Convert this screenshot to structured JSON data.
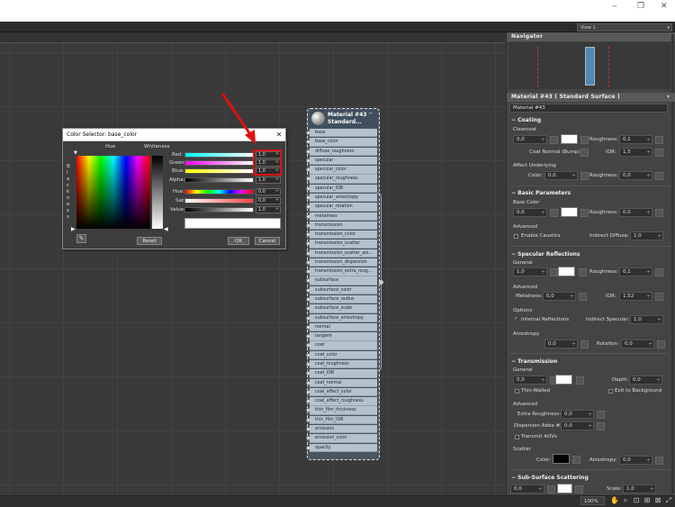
{
  "window": {
    "minimize": "‒",
    "maximize": "❐",
    "close": "✕",
    "view_select": "View 1"
  },
  "status": {
    "zoom": "100%"
  },
  "navigator": {
    "title": "Navigator"
  },
  "material_panel": {
    "header": "Material #43  ( Standard Surface )",
    "name": "Material #43",
    "coating": {
      "title": "Coating",
      "group": "Clearcoat",
      "weight": "0,0",
      "roughness_label": "Roughness:",
      "roughness": "0,1",
      "coat_normal_label": "Coat Normal (Bump):",
      "ior_label": "IOR:",
      "ior": "1,5",
      "affect_underlying": "Affect Underlying",
      "color_label": "Color:",
      "color_val": "0,0",
      "roughness2": "0,0"
    },
    "basic": {
      "title": "Basic Parameters",
      "group": "Base Color",
      "weight": "0,0",
      "roughness_label": "Roughness:",
      "roughness": "0,0",
      "advanced": "Advanced",
      "enable_caustics": "Enable Caustics",
      "indirect_diffuse_label": "Indirect Diffuse:",
      "indirect_diffuse": "1,0"
    },
    "specular": {
      "title": "Specular Reflections",
      "group": "General",
      "weight": "1,0",
      "roughness_label": "Roughness:",
      "roughness": "0,1",
      "advanced": "Advanced",
      "metalness_label": "Metalness:",
      "metalness": "0,0",
      "ior_label": "IOR:",
      "ior": "1,52",
      "options": "Options",
      "internal_reflections": "Internal Reflections",
      "indirect_specular_label": "Indirect Specular:",
      "indirect_specular": "1,0",
      "anisotropy": "Anisotropy",
      "anisotropy_val": "0,0",
      "rotation_label": "Rotation:",
      "rotation": "0,0"
    },
    "transmission": {
      "title": "Transmission",
      "group": "General",
      "weight": "0,0",
      "depth_label": "Depth:",
      "depth": "0,0",
      "thin_walled": "Thin-Walled",
      "exit_to_background": "Exit to Background",
      "advanced": "Advanced",
      "extra_roughness_label": "Extra Roughness:",
      "extra_roughness": "0,0",
      "dispersion_label": "Dispersion Abbe #:",
      "dispersion": "0,0",
      "transmit_aovs": "Transmit AOVs",
      "scatter": "Scatter",
      "color_label": "Color:",
      "anisotropy_label": "Anisotropy:",
      "anisotropy": "0,0"
    },
    "sss": {
      "title": "Sub-Surface Scattering",
      "weight": "0,0",
      "scale_label": "Scale:",
      "scale": "1,0"
    }
  },
  "node": {
    "title_line1": "Material #43",
    "title_line2": "Standard...",
    "slots": [
      "base",
      "base_color",
      "diffuse_roughness",
      "specular",
      "specular_color",
      "specular_roughness",
      "specular_IOR",
      "specular_anisotropy",
      "specular_rotation",
      "metalness",
      "transmission",
      "transmission_color",
      "transmission_scatter",
      "transmission_scatter_ani...",
      "transmission_dispersion",
      "transmission_extra_roug...",
      "subsurface",
      "subsurface_color",
      "subsurface_radius",
      "subsurface_scale",
      "subsurface_anisotropy",
      "normal",
      "tangent",
      "coat",
      "coat_color",
      "coat_roughness",
      "coat_IOR",
      "coat_normal",
      "coat_affect_color",
      "coat_affect_roughness",
      "thin_film_thickness",
      "thin_film_IOR",
      "emission",
      "emission_color",
      "opacity"
    ]
  },
  "color_selector": {
    "title": "Color Selector: base_color",
    "hue_label": "Hue",
    "whiteness_label": "Whiteness",
    "blackness_label": "B l a c k n e s s",
    "red_label": "Red:",
    "red": "1,0",
    "green_label": "Green:",
    "green": "1,0",
    "blue_label": "Blue:",
    "blue": "1,0",
    "alpha_label": "Alpha:",
    "alpha": "1,0",
    "hue_f_label": "Hue:",
    "hue": "0,0",
    "sat_label": "Sat:",
    "sat": "0,0",
    "value_label": "Value:",
    "value": "1,0",
    "reset": "Reset",
    "ok": "OK",
    "cancel": "Cancel"
  }
}
